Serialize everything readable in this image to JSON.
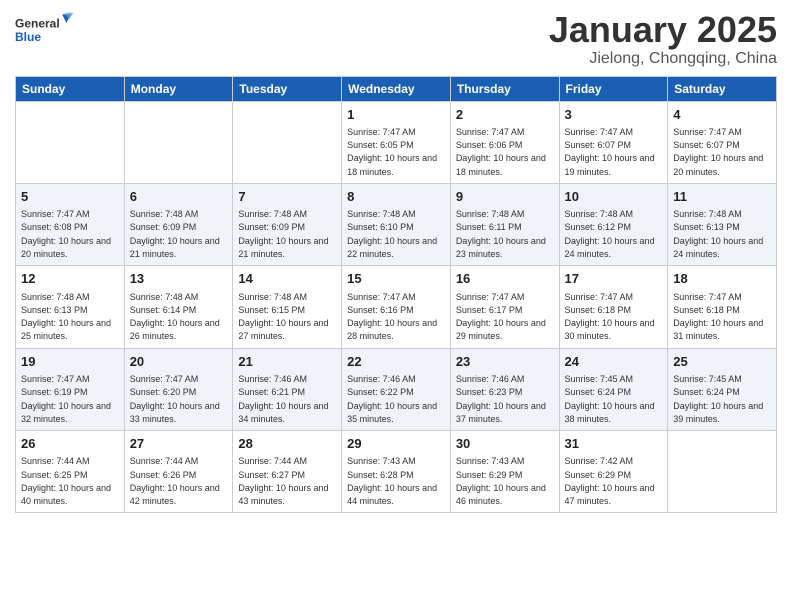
{
  "logo": {
    "general": "General",
    "blue": "Blue"
  },
  "title": "January 2025",
  "subtitle": "Jielong, Chongqing, China",
  "days_of_week": [
    "Sunday",
    "Monday",
    "Tuesday",
    "Wednesday",
    "Thursday",
    "Friday",
    "Saturday"
  ],
  "weeks": [
    [
      {
        "day": "",
        "sunrise": "",
        "sunset": "",
        "daylight": ""
      },
      {
        "day": "",
        "sunrise": "",
        "sunset": "",
        "daylight": ""
      },
      {
        "day": "",
        "sunrise": "",
        "sunset": "",
        "daylight": ""
      },
      {
        "day": "1",
        "sunrise": "Sunrise: 7:47 AM",
        "sunset": "Sunset: 6:05 PM",
        "daylight": "Daylight: 10 hours and 18 minutes."
      },
      {
        "day": "2",
        "sunrise": "Sunrise: 7:47 AM",
        "sunset": "Sunset: 6:06 PM",
        "daylight": "Daylight: 10 hours and 18 minutes."
      },
      {
        "day": "3",
        "sunrise": "Sunrise: 7:47 AM",
        "sunset": "Sunset: 6:07 PM",
        "daylight": "Daylight: 10 hours and 19 minutes."
      },
      {
        "day": "4",
        "sunrise": "Sunrise: 7:47 AM",
        "sunset": "Sunset: 6:07 PM",
        "daylight": "Daylight: 10 hours and 20 minutes."
      }
    ],
    [
      {
        "day": "5",
        "sunrise": "Sunrise: 7:47 AM",
        "sunset": "Sunset: 6:08 PM",
        "daylight": "Daylight: 10 hours and 20 minutes."
      },
      {
        "day": "6",
        "sunrise": "Sunrise: 7:48 AM",
        "sunset": "Sunset: 6:09 PM",
        "daylight": "Daylight: 10 hours and 21 minutes."
      },
      {
        "day": "7",
        "sunrise": "Sunrise: 7:48 AM",
        "sunset": "Sunset: 6:09 PM",
        "daylight": "Daylight: 10 hours and 21 minutes."
      },
      {
        "day": "8",
        "sunrise": "Sunrise: 7:48 AM",
        "sunset": "Sunset: 6:10 PM",
        "daylight": "Daylight: 10 hours and 22 minutes."
      },
      {
        "day": "9",
        "sunrise": "Sunrise: 7:48 AM",
        "sunset": "Sunset: 6:11 PM",
        "daylight": "Daylight: 10 hours and 23 minutes."
      },
      {
        "day": "10",
        "sunrise": "Sunrise: 7:48 AM",
        "sunset": "Sunset: 6:12 PM",
        "daylight": "Daylight: 10 hours and 24 minutes."
      },
      {
        "day": "11",
        "sunrise": "Sunrise: 7:48 AM",
        "sunset": "Sunset: 6:13 PM",
        "daylight": "Daylight: 10 hours and 24 minutes."
      }
    ],
    [
      {
        "day": "12",
        "sunrise": "Sunrise: 7:48 AM",
        "sunset": "Sunset: 6:13 PM",
        "daylight": "Daylight: 10 hours and 25 minutes."
      },
      {
        "day": "13",
        "sunrise": "Sunrise: 7:48 AM",
        "sunset": "Sunset: 6:14 PM",
        "daylight": "Daylight: 10 hours and 26 minutes."
      },
      {
        "day": "14",
        "sunrise": "Sunrise: 7:48 AM",
        "sunset": "Sunset: 6:15 PM",
        "daylight": "Daylight: 10 hours and 27 minutes."
      },
      {
        "day": "15",
        "sunrise": "Sunrise: 7:47 AM",
        "sunset": "Sunset: 6:16 PM",
        "daylight": "Daylight: 10 hours and 28 minutes."
      },
      {
        "day": "16",
        "sunrise": "Sunrise: 7:47 AM",
        "sunset": "Sunset: 6:17 PM",
        "daylight": "Daylight: 10 hours and 29 minutes."
      },
      {
        "day": "17",
        "sunrise": "Sunrise: 7:47 AM",
        "sunset": "Sunset: 6:18 PM",
        "daylight": "Daylight: 10 hours and 30 minutes."
      },
      {
        "day": "18",
        "sunrise": "Sunrise: 7:47 AM",
        "sunset": "Sunset: 6:18 PM",
        "daylight": "Daylight: 10 hours and 31 minutes."
      }
    ],
    [
      {
        "day": "19",
        "sunrise": "Sunrise: 7:47 AM",
        "sunset": "Sunset: 6:19 PM",
        "daylight": "Daylight: 10 hours and 32 minutes."
      },
      {
        "day": "20",
        "sunrise": "Sunrise: 7:47 AM",
        "sunset": "Sunset: 6:20 PM",
        "daylight": "Daylight: 10 hours and 33 minutes."
      },
      {
        "day": "21",
        "sunrise": "Sunrise: 7:46 AM",
        "sunset": "Sunset: 6:21 PM",
        "daylight": "Daylight: 10 hours and 34 minutes."
      },
      {
        "day": "22",
        "sunrise": "Sunrise: 7:46 AM",
        "sunset": "Sunset: 6:22 PM",
        "daylight": "Daylight: 10 hours and 35 minutes."
      },
      {
        "day": "23",
        "sunrise": "Sunrise: 7:46 AM",
        "sunset": "Sunset: 6:23 PM",
        "daylight": "Daylight: 10 hours and 37 minutes."
      },
      {
        "day": "24",
        "sunrise": "Sunrise: 7:45 AM",
        "sunset": "Sunset: 6:24 PM",
        "daylight": "Daylight: 10 hours and 38 minutes."
      },
      {
        "day": "25",
        "sunrise": "Sunrise: 7:45 AM",
        "sunset": "Sunset: 6:24 PM",
        "daylight": "Daylight: 10 hours and 39 minutes."
      }
    ],
    [
      {
        "day": "26",
        "sunrise": "Sunrise: 7:44 AM",
        "sunset": "Sunset: 6:25 PM",
        "daylight": "Daylight: 10 hours and 40 minutes."
      },
      {
        "day": "27",
        "sunrise": "Sunrise: 7:44 AM",
        "sunset": "Sunset: 6:26 PM",
        "daylight": "Daylight: 10 hours and 42 minutes."
      },
      {
        "day": "28",
        "sunrise": "Sunrise: 7:44 AM",
        "sunset": "Sunset: 6:27 PM",
        "daylight": "Daylight: 10 hours and 43 minutes."
      },
      {
        "day": "29",
        "sunrise": "Sunrise: 7:43 AM",
        "sunset": "Sunset: 6:28 PM",
        "daylight": "Daylight: 10 hours and 44 minutes."
      },
      {
        "day": "30",
        "sunrise": "Sunrise: 7:43 AM",
        "sunset": "Sunset: 6:29 PM",
        "daylight": "Daylight: 10 hours and 46 minutes."
      },
      {
        "day": "31",
        "sunrise": "Sunrise: 7:42 AM",
        "sunset": "Sunset: 6:29 PM",
        "daylight": "Daylight: 10 hours and 47 minutes."
      },
      {
        "day": "",
        "sunrise": "",
        "sunset": "",
        "daylight": ""
      }
    ]
  ]
}
